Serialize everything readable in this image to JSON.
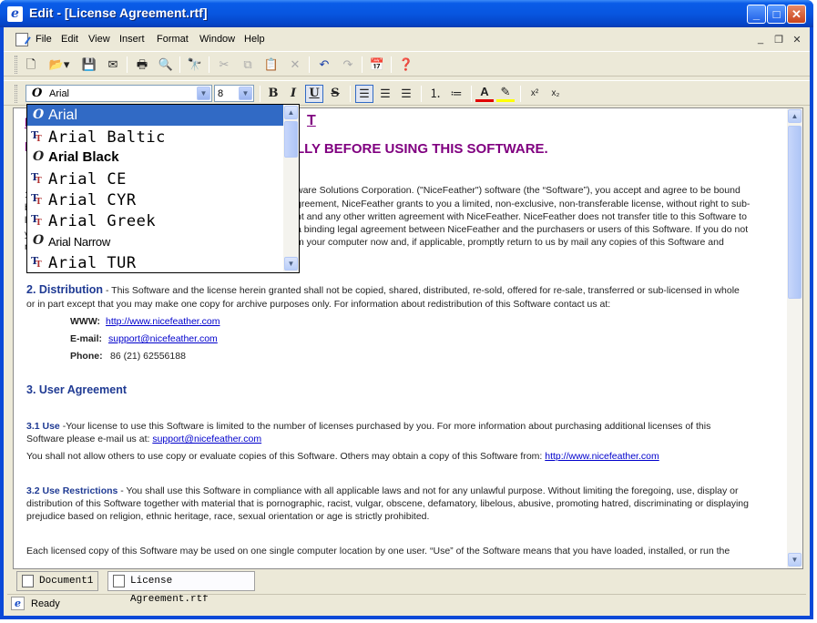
{
  "window": {
    "title": "Edit - [License Agreement.rtf]",
    "app_icon": "e-icon"
  },
  "menu": {
    "items": [
      "File",
      "Edit",
      "View",
      "Insert",
      "Format",
      "Window",
      "Help"
    ],
    "mdi_controls": [
      "_",
      "❐",
      "✕"
    ]
  },
  "toolbar": {
    "font_name": "Arial",
    "font_size": "8"
  },
  "font_dropdown": {
    "items": [
      {
        "label": "Arial",
        "type": "opentype",
        "selected": true
      },
      {
        "label": "Arial Baltic",
        "type": "truetype",
        "selected": false
      },
      {
        "label": "Arial Black",
        "type": "opentype",
        "selected": false
      },
      {
        "label": "Arial CE",
        "type": "truetype",
        "selected": false
      },
      {
        "label": "Arial CYR",
        "type": "truetype",
        "selected": false
      },
      {
        "label": "Arial Greek",
        "type": "truetype",
        "selected": false
      },
      {
        "label": "Arial Narrow",
        "type": "opentype",
        "selected": false
      },
      {
        "label": "Arial TUR",
        "type": "truetype",
        "selected": false
      }
    ]
  },
  "document": {
    "heading_partial": "LLY BEFORE USING THIS SOFTWARE.",
    "heading_link_partial": "T",
    "sec1": {
      "l1": "ware Solutions Corporation. (\"NiceFeather\") software (the “Software”), you accept and agree to be bound",
      "l2": "greement, NiceFeather grants to you a limited, non-exclusive, non-transferable license, without right to sub-",
      "l3": "nt and any other written agreement with NiceFeather. NiceFeather does not transfer title to this Software to",
      "l4": "a binding legal agreement between NiceFeather and the purchasers or users of this Software. If you do not",
      "l5": "m your computer now and, if applicable, promptly return to us by mail any copies of this Software and"
    },
    "sec2": {
      "heading": "2. Distribution",
      "l1": " - This Software and the license herein granted shall not be copied, shared, distributed, re-sold, offered for re-sale, transferred or sub-licensed in whole",
      "l2": "or in part except that you may make one copy for archive purposes only.  For information about redistribution of this Software contact us at:",
      "www_label": "WWW:",
      "www_value": "http://www.nicefeather.com",
      "email_label": "E-mail:",
      "email_value": "support@nicefeather.com",
      "phone_label": "Phone:",
      "phone_value": "86 (21) 62556188"
    },
    "sec3": {
      "heading": "3. User Agreement",
      "s31_heading": "3.1 Use",
      "s31_l1": " -Your license to use this Software is limited to the number of licenses purchased by you. For more information about purchasing additional licenses of this",
      "s31_l2": "Software please e-mail us at: ",
      "s31_email": "support@nicefeather.com",
      "s31_l3": "You shall not allow others to use copy or evaluate copies of this Software. Others may obtain a copy of this Software from: ",
      "s31_link": "http://www.nicefeather.com",
      "s32_heading": "3.2 Use Restrictions",
      "s32_l1": " - You shall use this Software in compliance with all applicable laws and not for any unlawful purpose.   Without limiting the foregoing, use, display or",
      "s32_l2": "distribution of this Software together with material that is pornographic, racist, vulgar, obscene, defamatory, libelous, abusive, promoting hatred, discriminating or displaying",
      "s32_l3": "prejudice based on religion, ethnic heritage, race, sexual orientation or age is strictly prohibited.",
      "last": "Each licensed copy of this Software may be used on one single computer location by one user.  “Use” of the Software means that you have loaded, installed, or run the"
    },
    "left_fragments": [
      "1",
      "b",
      "l",
      "y",
      "n"
    ]
  },
  "tabs": [
    {
      "label": "Document1",
      "active": false
    },
    {
      "label": "License Agreement.rtf",
      "active": true
    }
  ],
  "status": {
    "text": "Ready"
  }
}
